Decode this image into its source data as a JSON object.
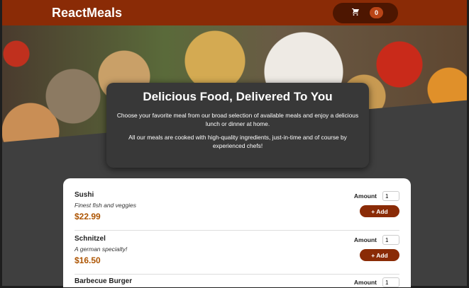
{
  "header": {
    "title": "ReactMeals",
    "cart_icon": "cart-icon",
    "cart_count": "0"
  },
  "summary": {
    "title": "Delicious Food, Delivered To You",
    "paragraph1": "Choose your favorite meal from our broad selection of available meals and enjoy a delicious lunch or dinner at home.",
    "paragraph2": "All our meals are cooked with high-quality ingredients, just-in-time and of course by experienced chefs!"
  },
  "meals": [
    {
      "name": "Sushi",
      "description": "Finest fish and veggies",
      "price": "$22.99",
      "amount_label": "Amount",
      "amount": "1",
      "add_label": "+ Add"
    },
    {
      "name": "Schnitzel",
      "description": "A german specialty!",
      "price": "$16.50",
      "amount_label": "Amount",
      "amount": "1",
      "add_label": "+ Add"
    },
    {
      "name": "Barbecue Burger",
      "amount_label": "Amount",
      "amount": "1"
    }
  ],
  "colors": {
    "header": "#8a2b06",
    "price": "#ad5502",
    "background": "#3f3f3f"
  }
}
